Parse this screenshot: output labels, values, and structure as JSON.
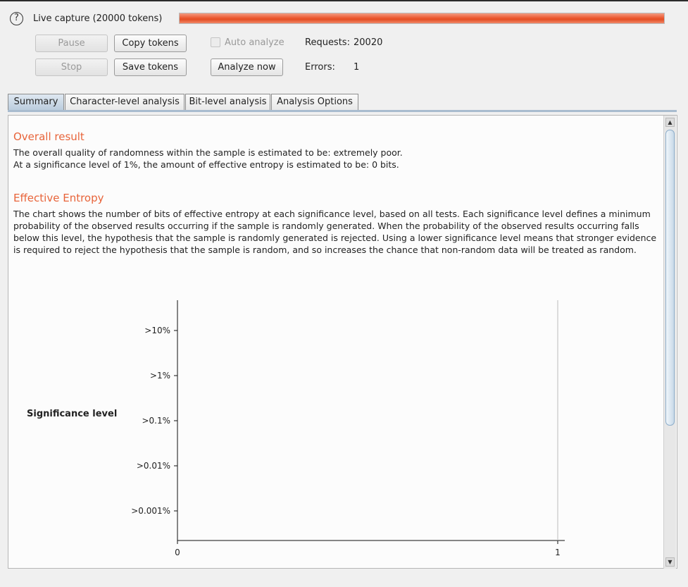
{
  "header": {
    "capture_title": "Live capture (20000 tokens)",
    "help_icon": "question-circle-icon",
    "progress_fraction": 1.0,
    "progress_color": "#e44d22"
  },
  "controls": {
    "pause_label": "Pause",
    "copy_tokens_label": "Copy tokens",
    "auto_analyze_label": "Auto analyze",
    "auto_analyze_checked": false,
    "stop_label": "Stop",
    "save_tokens_label": "Save tokens",
    "analyze_now_label": "Analyze now",
    "requests_label": "Requests:",
    "requests_value": "20020",
    "errors_label": "Errors:",
    "errors_value": "1"
  },
  "tabs": [
    {
      "label": "Summary",
      "active": true
    },
    {
      "label": "Character-level analysis",
      "active": false
    },
    {
      "label": "Bit-level analysis",
      "active": false
    },
    {
      "label": "Analysis Options",
      "active": false
    }
  ],
  "summary": {
    "overall_title": "Overall result",
    "overall_line1": "The overall quality of randomness within the sample is estimated to be: extremely poor.",
    "overall_line2": "At a significance level of 1%, the amount of effective entropy is estimated to be: 0 bits.",
    "entropy_title": "Effective Entropy",
    "entropy_text": "The chart shows the number of bits of effective entropy at each significance level, based on all tests. Each significance level defines a minimum probability of the observed results occurring if the sample is randomly generated. When the probability of the observed results occurring falls below this level, the hypothesis that the sample is randomly generated is rejected. Using a lower significance level means that stronger evidence is required to reject the hypothesis that the sample is random, and so increases the chance that non-random data will be treated as random."
  },
  "accent_color": "#e8643a",
  "chart_data": {
    "type": "bar",
    "orientation": "horizontal",
    "categories": [
      ">10%",
      ">1%",
      ">0.1%",
      ">0.01%",
      ">0.001%"
    ],
    "values": [
      0,
      0,
      0,
      0,
      0
    ],
    "xlabel": "",
    "ylabel": "Significance level",
    "xlim": [
      0,
      1
    ],
    "x_ticks": [
      "0",
      "1"
    ],
    "grid": false
  }
}
